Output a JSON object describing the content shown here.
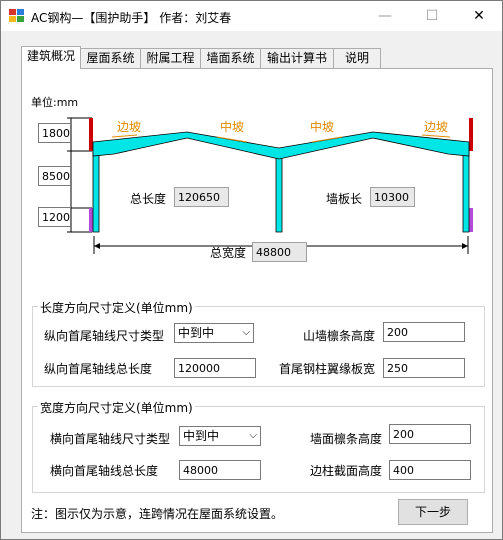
{
  "window": {
    "title": "AC钢构—【围护助手】 作者：刘艾春",
    "min_glyph": "—",
    "max_glyph": "☐",
    "close_glyph": "✕"
  },
  "tabs": [
    "建筑概况",
    "屋面系统",
    "附属工程",
    "墙面系统",
    "输出计算书",
    "说明"
  ],
  "diagram": {
    "unit_label": "单位:mm",
    "slope_labels": [
      "边坡",
      "中坡",
      "中坡",
      "边坡"
    ],
    "left_heights": [
      "1800",
      "8500",
      "1200"
    ],
    "total_length_label": "总长度",
    "total_length_value": "120650",
    "wall_length_label": "墙板长",
    "wall_length_value": "10300",
    "total_width_label": "总宽度",
    "total_width_value": "48800",
    "colors": {
      "frame": "#00e5e5",
      "red": "#cc0000",
      "purple": "#b44bd8",
      "slope_text": "#e08a00"
    }
  },
  "length_group": {
    "title": "长度方向尺寸定义(单位mm)",
    "axis_type_label": "纵向首尾轴线尺寸类型",
    "axis_type_value": "中到中",
    "gable_purlin_label": "山墙檩条高度",
    "gable_purlin_value": "200",
    "axis_total_label": "纵向首尾轴线总长度",
    "axis_total_value": "120000",
    "flange_label": "首尾钢柱翼缘板宽",
    "flange_value": "250"
  },
  "width_group": {
    "title": "宽度方向尺寸定义(单位mm)",
    "axis_type_label": "横向首尾轴线尺寸类型",
    "axis_type_value": "中到中",
    "wall_purlin_label": "墙面檩条高度",
    "wall_purlin_value": "200",
    "axis_total_label": "横向首尾轴线总长度",
    "axis_total_value": "48000",
    "edge_col_label": "边柱截面高度",
    "edge_col_value": "400"
  },
  "note": "注：图示仅为示意，连跨情况在屋面系统设置。",
  "next_button": "下一步"
}
